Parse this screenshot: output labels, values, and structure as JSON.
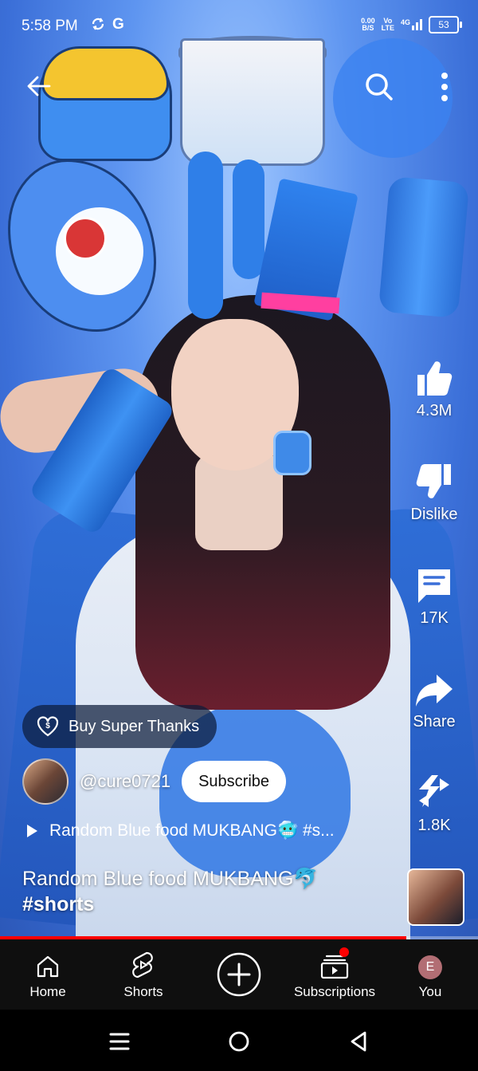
{
  "status_bar": {
    "time": "5:58 PM",
    "icons_left": [
      "sync-icon",
      "google-icon"
    ],
    "network_speed_value": "0.00",
    "network_speed_unit": "B/S",
    "volte": "Vo",
    "lte": "LTE",
    "signal": "4G",
    "battery": "53"
  },
  "top_bar": {
    "back_icon": "arrow-left-icon",
    "search_icon": "search-icon",
    "more_icon": "more-vertical-icon"
  },
  "right_rail": {
    "like": {
      "icon": "thumbs-up-icon",
      "label": "4.3M"
    },
    "dislike": {
      "icon": "thumbs-down-icon",
      "label": "Dislike"
    },
    "comments": {
      "icon": "comment-icon",
      "label": "17K"
    },
    "share": {
      "icon": "share-icon",
      "label": "Share"
    },
    "remix": {
      "icon": "remix-icon",
      "label": "1.8K"
    }
  },
  "overlay": {
    "super_thanks_label": "Buy Super Thanks",
    "channel_handle": "@cure0721",
    "subscribe_label": "Subscribe",
    "playlist_title": "Random Blue food MUKBANG🥶 #s...",
    "title_line1": "Random Blue food MUKBANG🐬",
    "title_line2": "#shorts"
  },
  "progress": {
    "played_fraction": 0.85
  },
  "bottom_nav": {
    "home": "Home",
    "shorts": "Shorts",
    "subscriptions": "Subscriptions",
    "you": "You",
    "you_avatar_letter": "E"
  },
  "colors": {
    "accent_red": "#ff0000",
    "nav_background": "#0f0f0f",
    "scene_blue": "#3b6fd8"
  }
}
